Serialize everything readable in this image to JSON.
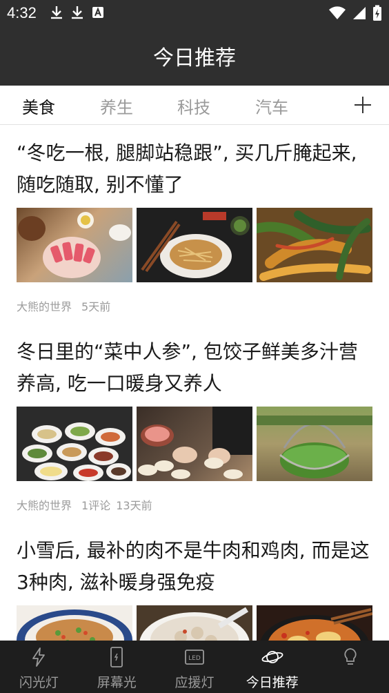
{
  "status_bar": {
    "time": "4:32"
  },
  "header": {
    "title": "今日推荐"
  },
  "tabs": [
    {
      "label": "美食"
    },
    {
      "label": "养生"
    },
    {
      "label": "科技"
    },
    {
      "label": "汽车"
    }
  ],
  "articles": [
    {
      "title": "“冬吃一根, 腿脚站稳跟”, 买几斤腌起来, 随吃随取, 别不懂了",
      "author": "大熊的世界",
      "comments": "",
      "time": "5天前",
      "images": [
        "food-photo",
        "food-photo",
        "food-photo"
      ]
    },
    {
      "title": "冬日里的“菜中人参”, 包饺子鲜美多汁营养高, 吃一口暖身又养人",
      "author": "大熊的世界",
      "comments": "1评论",
      "time": "13天前",
      "images": [
        "food-photo",
        "food-photo",
        "food-photo"
      ]
    },
    {
      "title": "小雪后, 最补的肉不是牛肉和鸡肉, 而是这3种肉, 滋补暖身强免疫",
      "author": "",
      "comments": "",
      "time": "",
      "images": [
        "food-photo",
        "food-photo",
        "food-photo"
      ]
    }
  ],
  "bottom_nav": [
    {
      "label": "闪光灯",
      "icon": "flash-icon"
    },
    {
      "label": "屏幕光",
      "icon": "phone-screen-icon"
    },
    {
      "label": "应援灯",
      "icon": "led-icon"
    },
    {
      "label": "今日推荐",
      "icon": "planet-icon"
    },
    {
      "label": "",
      "icon": "bulb-icon"
    }
  ],
  "colors": {
    "header": "#2f2f2f",
    "nav_bg": "#1e1e1e",
    "active_tab": "#111111",
    "inactive": "#9a9a9a"
  }
}
